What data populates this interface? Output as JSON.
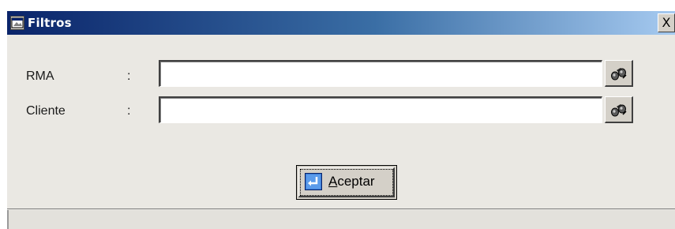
{
  "window": {
    "title": "Filtros",
    "close_symbol": "X",
    "icon": "app-window-icon"
  },
  "form": {
    "fields": [
      {
        "label": "RMA",
        "separator": ":",
        "value": "",
        "lookup_icon": "binoculars-search-icon"
      },
      {
        "label": "Cliente",
        "separator": ":",
        "value": "",
        "lookup_icon": "binoculars-search-icon"
      }
    ]
  },
  "footer": {
    "accept_label": "Aceptar",
    "accept_icon": "enter-return-icon"
  },
  "colors": {
    "titlebar_start": "#0a246a",
    "titlebar_end": "#a6caf0",
    "face": "#d4d0c8"
  }
}
